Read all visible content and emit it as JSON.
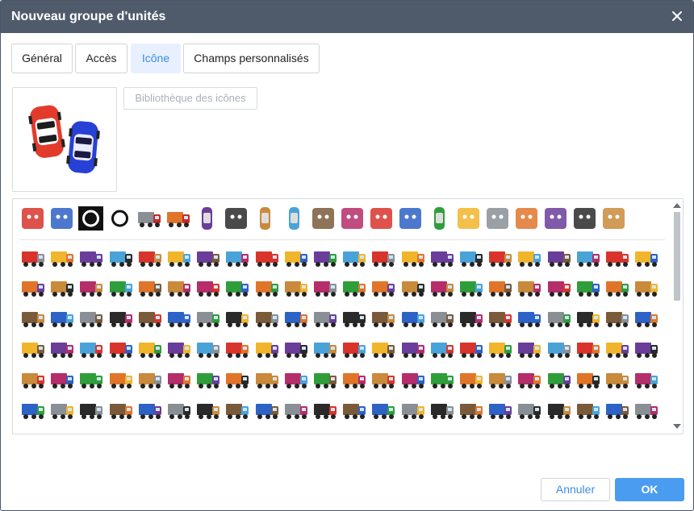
{
  "dialog": {
    "title": "Nouveau groupe d'unités"
  },
  "tabs": [
    {
      "label": "Général",
      "active": false
    },
    {
      "label": "Accès",
      "active": false
    },
    {
      "label": "Icône",
      "active": true
    },
    {
      "label": "Champs personnalisés",
      "active": false
    }
  ],
  "icon_library_button": "Bibliothèque des icônes",
  "footer": {
    "cancel_label": "Annuler",
    "ok_label": "OK"
  },
  "colors": {
    "titlebar": "#4f5b6b",
    "accent": "#3d8ce6",
    "ok_button": "#4a9cf0",
    "tab_active_bg": "#e8f0fe"
  },
  "icons": {
    "close": "close-icon",
    "preview": "car-pair-icon",
    "gallery_featured": [
      "anime-girl-icon",
      "anime-elf-icon",
      "biohazard-black-icon",
      "biohazard-icon",
      "fire-truck-icon",
      "crane-truck-icon",
      "red-car-icon",
      "black-phone-icon",
      "pink-car-icon",
      "red-sportscar-icon",
      "cone-icon",
      "broken-image-icon",
      "ghost-icon",
      "pichu-icon",
      "black-car-icon",
      "tram-badge-icon",
      "pikachu-icon",
      "motorcycle-icon",
      "plane-icon",
      "fox-icon",
      "red-eye-ghost-icon"
    ]
  }
}
